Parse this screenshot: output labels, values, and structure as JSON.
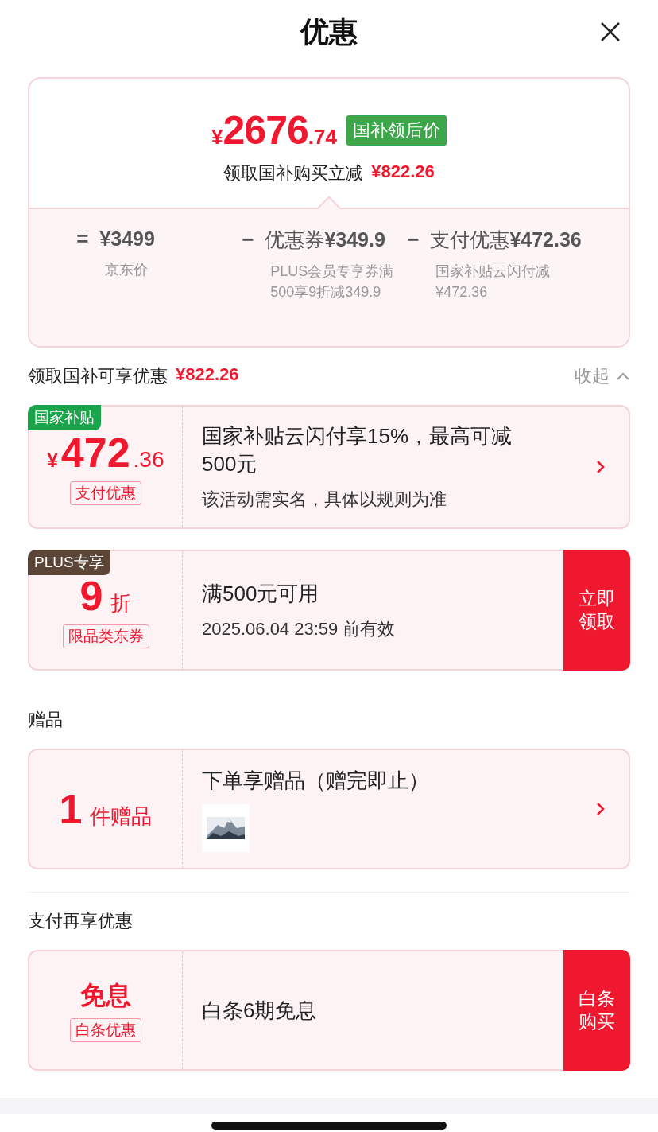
{
  "header": {
    "title": "优惠"
  },
  "summary": {
    "currency": "¥",
    "integer": "2676",
    "decimal": ".74",
    "price_tag": "国补领后价",
    "subtitle": "领取国补购买立减",
    "subtitle_amount": "¥822.26",
    "breakdown": [
      {
        "operator": "=",
        "amount": "¥3499",
        "note": "京东价"
      },
      {
        "operator": "−",
        "name": "优惠券",
        "amount": "¥349.9",
        "note": "PLUS会员专享券满500享9折减349.9"
      },
      {
        "operator": "−",
        "name": "支付优惠",
        "amount": "¥472.36",
        "note": "国家补贴云闪付减¥472.36"
      }
    ]
  },
  "sections": [
    {
      "kind": "group",
      "title": "领取国补可享优惠",
      "amount": "¥822.26",
      "toggle": "收起",
      "expanded": true,
      "coupons": [
        {
          "badge": "国家补贴",
          "color": "#1aa34a",
          "currency": "¥",
          "main": "472",
          "decimal": ".36",
          "tag": "支付优惠",
          "title": "国家补贴云闪付享15%，最高可减 500元",
          "note": "该活动需实名，具体以规则为准",
          "action": {
            "kind": "arrow"
          }
        },
        {
          "badge": "PLUS专享",
          "color": "#5a4536",
          "main": "9",
          "unit": "折",
          "tag": "限品类东券",
          "title": "满500元可用",
          "note": "2025.06.04 23:59 前有效",
          "action": {
            "kind": "button",
            "label": "立即领取"
          }
        }
      ]
    },
    {
      "kind": "group",
      "title": "赠品",
      "coupons": [
        {
          "main": "1",
          "unit": "件赠品",
          "title": "下单享赠品（赠完即止）",
          "action": {
            "kind": "arrow"
          }
        }
      ]
    },
    {
      "kind": "divider"
    },
    {
      "kind": "group",
      "title": "支付再享优惠",
      "coupons": [
        {
          "word": "免息",
          "tag": "白条优惠",
          "title": "白条6期免息",
          "action": {
            "kind": "button",
            "label": "白条购买"
          }
        }
      ]
    }
  ]
}
